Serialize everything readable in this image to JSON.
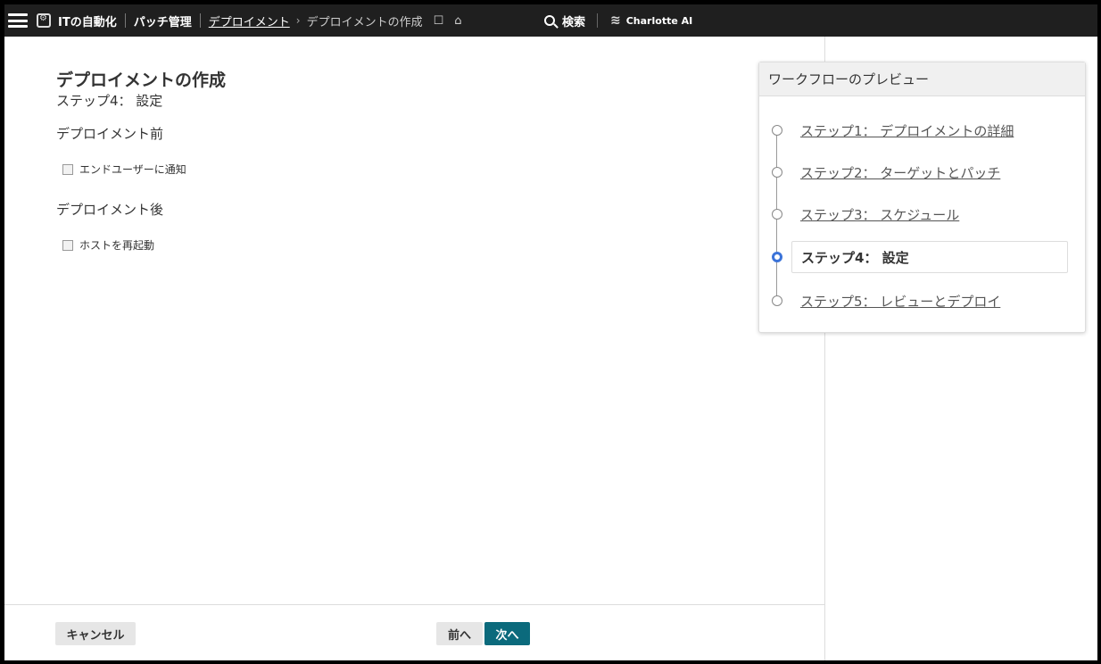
{
  "header": {
    "app_name": "ITの自動化",
    "section": "パッチ管理",
    "breadcrumb_link": "デプロイメント",
    "breadcrumb_current": "デプロイメントの作成",
    "search_label": "検索",
    "ai_label": "Charlotte AI"
  },
  "main": {
    "title": "デプロイメントの作成",
    "subtitle": "ステップ4： 設定",
    "pre_section": "デプロイメント前",
    "pre_option": "エンドユーザーに通知",
    "post_section": "デプロイメント後",
    "post_option": "ホストを再起動"
  },
  "footer": {
    "cancel_label": "キャンセル",
    "prev_label": "前へ",
    "next_label": "次へ"
  },
  "preview": {
    "title": "ワークフローのプレビュー",
    "steps": [
      {
        "label": "ステップ1： デプロイメントの詳細"
      },
      {
        "label": "ステップ2： ターゲットとパッチ"
      },
      {
        "label": "ステップ3： スケジュール"
      },
      {
        "label": "ステップ4： 設定"
      },
      {
        "label": "ステップ5： レビューとデプロイ"
      }
    ]
  },
  "colors": {
    "topbar": "#1f1f1f",
    "primary_button": "#0b6a7c",
    "active_step": "#3b73d9"
  }
}
